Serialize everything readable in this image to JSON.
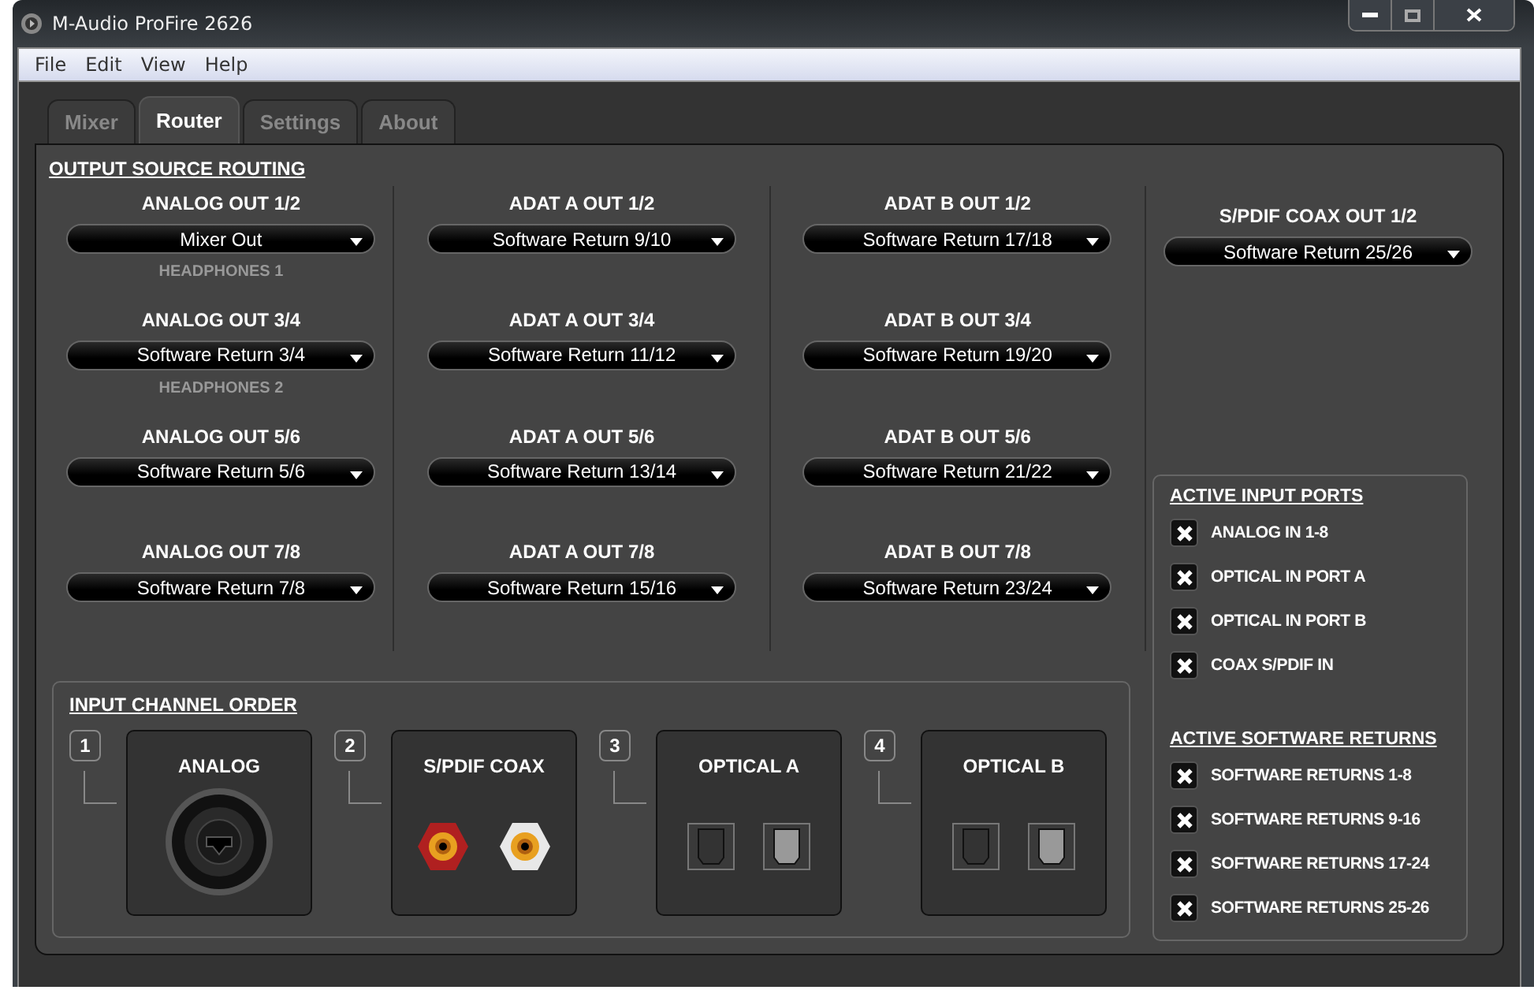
{
  "window": {
    "title": "M-Audio ProFire 2626"
  },
  "menu": [
    "File",
    "Edit",
    "View",
    "Help"
  ],
  "tabs": [
    {
      "label": "Mixer",
      "selected": false
    },
    {
      "label": "Router",
      "selected": true
    },
    {
      "label": "Settings",
      "selected": false
    },
    {
      "label": "About",
      "selected": false
    }
  ],
  "output_source_routing": {
    "title": "OUTPUT SOURCE ROUTING",
    "columns": [
      [
        {
          "label": "ANALOG OUT 1/2",
          "value": "Mixer Out",
          "note": "HEADPHONES 1"
        },
        {
          "label": "ANALOG OUT 3/4",
          "value": "Software Return 3/4",
          "note": "HEADPHONES 2"
        },
        {
          "label": "ANALOG OUT 5/6",
          "value": "Software Return 5/6"
        },
        {
          "label": "ANALOG OUT 7/8",
          "value": "Software Return 7/8"
        }
      ],
      [
        {
          "label": "ADAT A OUT 1/2",
          "value": "Software Return 9/10"
        },
        {
          "label": "ADAT A OUT 3/4",
          "value": "Software Return 11/12"
        },
        {
          "label": "ADAT A OUT 5/6",
          "value": "Software Return 13/14"
        },
        {
          "label": "ADAT A OUT 7/8",
          "value": "Software Return 15/16"
        }
      ],
      [
        {
          "label": "ADAT B OUT 1/2",
          "value": "Software Return 17/18"
        },
        {
          "label": "ADAT B OUT 3/4",
          "value": "Software Return 19/20"
        },
        {
          "label": "ADAT B OUT 5/6",
          "value": "Software Return 21/22"
        },
        {
          "label": "ADAT B OUT 7/8",
          "value": "Software Return 23/24"
        }
      ],
      [
        {
          "label": "S/PDIF COAX OUT 1/2",
          "value": "Software Return 25/26"
        }
      ]
    ]
  },
  "input_channel_order": {
    "title": "INPUT CHANNEL ORDER",
    "items": [
      {
        "number": "1",
        "label": "ANALOG",
        "kind": "combo"
      },
      {
        "number": "2",
        "label": "S/PDIF COAX",
        "kind": "rca"
      },
      {
        "number": "3",
        "label": "OPTICAL A",
        "kind": "optical"
      },
      {
        "number": "4",
        "label": "OPTICAL B",
        "kind": "optical"
      }
    ]
  },
  "active_input_ports": {
    "title": "ACTIVE INPUT PORTS",
    "items": [
      {
        "label": "ANALOG IN 1-8",
        "checked": true
      },
      {
        "label": "OPTICAL IN PORT A",
        "checked": true
      },
      {
        "label": "OPTICAL IN PORT B",
        "checked": true
      },
      {
        "label": "COAX S/PDIF IN",
        "checked": true
      }
    ]
  },
  "active_software_returns": {
    "title": "ACTIVE SOFTWARE RETURNS",
    "items": [
      {
        "label": "SOFTWARE RETURNS 1-8",
        "checked": true
      },
      {
        "label": "SOFTWARE RETURNS 9-16",
        "checked": true
      },
      {
        "label": "SOFTWARE RETURNS 17-24",
        "checked": true
      },
      {
        "label": "SOFTWARE RETURNS 25-26",
        "checked": true
      }
    ]
  }
}
